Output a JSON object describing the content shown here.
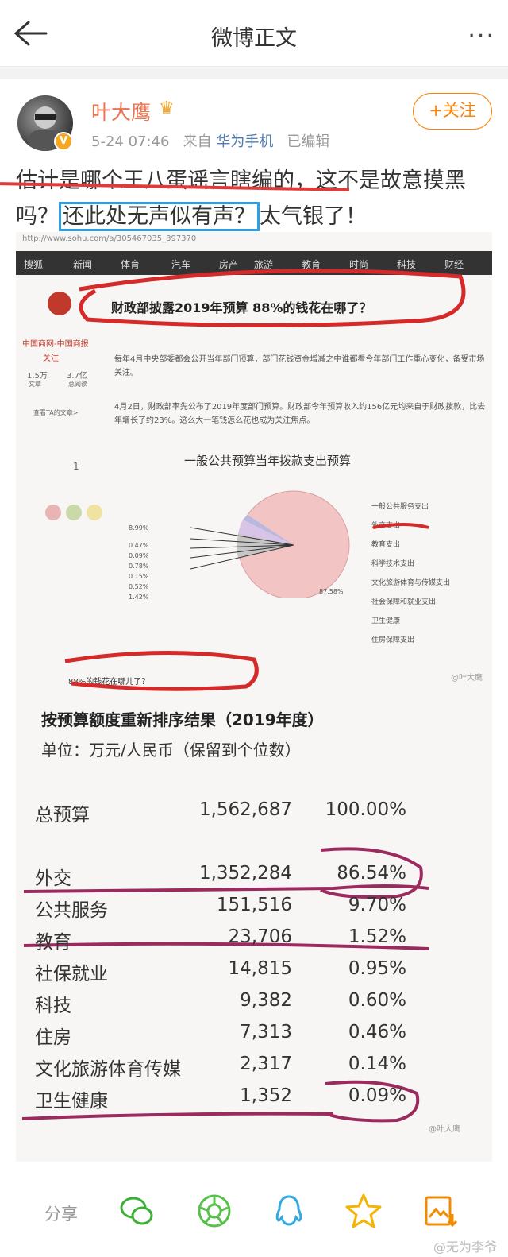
{
  "header": {
    "title": "微博正文",
    "more": "···"
  },
  "user": {
    "name": "叶大鹰",
    "time": "5-24 07:46",
    "from_prefix": "来自",
    "source": "华为手机",
    "edited": "已编辑",
    "follow": "+关注"
  },
  "post": {
    "part1": "估计是哪个王八蛋谣言瞎编的，这不是故意摸黑吗？",
    "highlight": "还此处无声似有声？",
    "part2": "太气银了！"
  },
  "embedded": {
    "url": "http://www.sohu.com/a/305467035_397370",
    "nav": [
      "搜狐",
      "新闻",
      "体育",
      "汽车",
      "房产",
      "旅游",
      "教育",
      "时尚",
      "科技",
      "财经"
    ],
    "headline": "财政部披露2019年预算 88%的钱花在哪了？",
    "para1": "每年4月中央部委都会公开当年部门预算，部门花钱资金增减之中谁都看今年部门工作重心变化，备受市场关注。",
    "para2": "4月2日，财政部率先公布了2019年度部门预算。财政部今年预算收入约156亿元均来自于财政拨款，比去年增长了约23%。这么大一笔钱怎么花也成为关注焦点。",
    "side": {
      "name": "中国商网-中国商报",
      "fans_label": "关注",
      "stat1": "1.5万",
      "stat1_label": "文章",
      "stat2": "3.7亿",
      "stat2_label": "总阅读",
      "more": "查看TA的文章>",
      "count": "1"
    },
    "pie_title": "一般公共预算当年拨款支出预算",
    "legend": [
      "一般公共服务支出",
      "外交支出",
      "教育支出",
      "科学技术支出",
      "文化旅游体育与传媒支出",
      "社会保障和就业支出",
      "卫生健康",
      "住房保障支出"
    ],
    "left_labels": [
      "8.99%",
      "0.47%",
      "0.09%",
      "0.78%",
      "0.15%",
      "0.52%",
      "1.42%"
    ],
    "big_label": "87.58%",
    "caption": "88%的钱花在哪儿了？",
    "watermark1": "@叶大鹰"
  },
  "table": {
    "title": "按预算额度重新排序结果（2019年度）",
    "unit": "单位：万元/人民币（保留到个位数）",
    "rows": [
      {
        "name": "总预算",
        "value": "1,562,687",
        "pct": "100.00%"
      },
      {
        "name": "外交",
        "value": "1,352,284",
        "pct": "86.54%"
      },
      {
        "name": "公共服务",
        "value": "151,516",
        "pct": "9.70%"
      },
      {
        "name": "教育",
        "value": "23,706",
        "pct": "1.52%"
      },
      {
        "name": "社保就业",
        "value": "14,815",
        "pct": "0.95%"
      },
      {
        "name": "科技",
        "value": "9,382",
        "pct": "0.60%"
      },
      {
        "name": "住房",
        "value": "7,313",
        "pct": "0.46%"
      },
      {
        "name": "文化旅游体育传媒",
        "value": "2,317",
        "pct": "0.14%"
      },
      {
        "name": "卫生健康",
        "value": "1,352",
        "pct": "0.09%"
      }
    ],
    "watermark2": "@叶大鹰"
  },
  "share": {
    "label": "分享",
    "icons": [
      "wechat-icon",
      "moments-icon",
      "qq-icon",
      "qzone-icon",
      "save-image-icon"
    ]
  },
  "watermark": "@无为李爷",
  "colors": {
    "accent": "#ff8200",
    "username": "#eb7350",
    "link": "#507daf",
    "highlight_box": "#2aa0e6"
  }
}
